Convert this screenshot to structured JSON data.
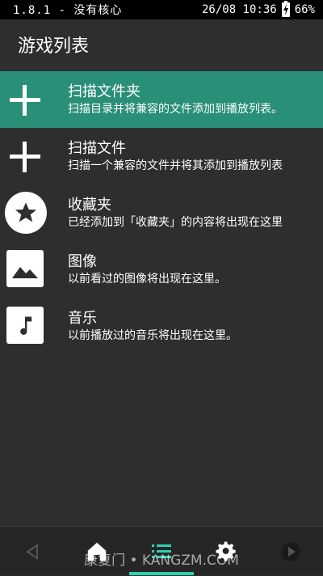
{
  "status_bar": {
    "left_text": "1.8.1 - 没有核心",
    "datetime": "26/08 10:36",
    "battery": "66%"
  },
  "app_bar": {
    "title": "游戏列表"
  },
  "list": [
    {
      "icon": "plus-icon",
      "title": "扫描文件夹",
      "subtitle": "扫描目录并将兼容的文件添加到播放列表。",
      "active": true
    },
    {
      "icon": "plus-icon",
      "title": "扫描文件",
      "subtitle": "扫描一个兼容的文件并将其添加到播放列表",
      "active": false
    },
    {
      "icon": "star-icon",
      "title": "收藏夹",
      "subtitle": "已经添加到「收藏夹」的内容将出现在这里",
      "active": false
    },
    {
      "icon": "image-icon",
      "title": "图像",
      "subtitle": "以前看过的图像将出现在这里。",
      "active": false
    },
    {
      "icon": "music-note-icon",
      "title": "音乐",
      "subtitle": "以前播放过的音乐将出现在这里。",
      "active": false
    }
  ],
  "nav_bar": {
    "items": [
      "back-icon",
      "home-icon",
      "list-icon",
      "gear-icon",
      "play-icon"
    ],
    "selected_index": 2,
    "accent_color": "#2fd0b0"
  },
  "watermark": "康复门 • KANGZM.COM",
  "colors": {
    "background": "#2e2e2e",
    "active_row": "#2a8f78",
    "status_bar": "#000000"
  }
}
